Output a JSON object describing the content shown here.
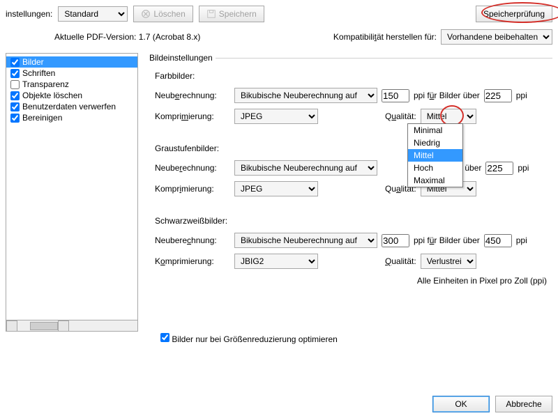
{
  "top": {
    "settings_label": "instellungen:",
    "settings_value": "Standard",
    "delete_label": "Löschen",
    "save_label": "Speichern",
    "memcheck_label": "Speicherprüfung"
  },
  "info": {
    "pdf_version": "Aktuelle PDF-Version: 1.7 (Acrobat 8.x)",
    "compat_label": "Kompatibilität herstellen für:",
    "compat_value": "Vorhandene beibehalten"
  },
  "sidebar": {
    "items": [
      {
        "label": "Bilder",
        "checked": true,
        "selected": true
      },
      {
        "label": "Schriften",
        "checked": true
      },
      {
        "label": "Transparenz",
        "checked": false
      },
      {
        "label": "Objekte löschen",
        "checked": true
      },
      {
        "label": "Benutzerdaten verwerfen",
        "checked": true
      },
      {
        "label": "Bereinigen",
        "checked": true
      }
    ]
  },
  "content": {
    "fieldset_title": "Bildeinstellungen",
    "sections": {
      "color": {
        "title": "Farbbilder:",
        "recalc_label": "Neuberechnung:",
        "recalc_value": "Bikubische Neuberechnung auf",
        "ppi1": "150",
        "ppi_for": "ppi für Bilder über",
        "ppi2": "225",
        "ppi_unit": "ppi",
        "compress_label": "Komprimierung:",
        "compress_value": "JPEG",
        "quality_label": "Qualität:",
        "quality_value": "Mittel",
        "quality_options": [
          "Minimal",
          "Niedrig",
          "Mittel",
          "Hoch",
          "Maximal"
        ]
      },
      "gray": {
        "title": "Graustufenbilder:",
        "recalc_label": "Neuberechnung:",
        "recalc_value": "Bikubische Neuberechnung auf",
        "ppi_for": "lder über",
        "ppi2": "225",
        "ppi_unit": "ppi",
        "compress_label": "Komprimierung:",
        "compress_value": "JPEG",
        "quality_label": "Qualität:",
        "quality_value": "Mittel"
      },
      "bw": {
        "title": "Schwarzweißbilder:",
        "recalc_label": "Neuberechnung:",
        "recalc_value": "Bikubische Neuberechnung auf",
        "ppi1": "300",
        "ppi_for": "ppi für Bilder über",
        "ppi2": "450",
        "ppi_unit": "ppi",
        "compress_label": "Komprimierung:",
        "compress_value": "JBIG2",
        "quality_label": "Qualität:",
        "quality_value": "Verlustreich"
      }
    },
    "footer_note": "Alle Einheiten in Pixel pro Zoll (ppi)",
    "optimize_label": "Bilder nur bei Größenreduzierung optimieren",
    "optimize_checked": true
  },
  "buttons": {
    "ok": "OK",
    "cancel": "Abbreche"
  }
}
